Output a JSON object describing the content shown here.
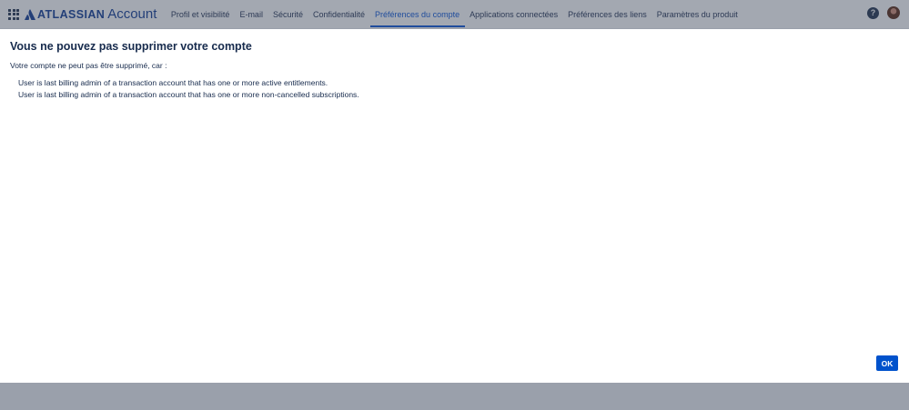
{
  "header": {
    "brand": "ATLASSIAN",
    "product": "Account",
    "nav": [
      {
        "label": "Profil et visibilité"
      },
      {
        "label": "E-mail"
      },
      {
        "label": "Sécurité"
      },
      {
        "label": "Confidentialité"
      },
      {
        "label": "Préférences du compte"
      },
      {
        "label": "Applications connectées"
      },
      {
        "label": "Préférences des liens"
      },
      {
        "label": "Paramètres du produit"
      }
    ],
    "active_index": 4,
    "help_label": "?"
  },
  "modal": {
    "title": "Vous ne pouvez pas supprimer votre compte",
    "intro": "Votre compte ne peut pas être supprimé, car :",
    "reasons": [
      "User is last billing admin of a transaction account that has one or more active entitlements.",
      "User is last billing admin of a transaction account that has one or more non-cancelled subscriptions."
    ],
    "ok_label": "OK"
  },
  "colors": {
    "accent": "#0052cc",
    "overlay": "#9aa0ab",
    "text": "#172b4d"
  }
}
